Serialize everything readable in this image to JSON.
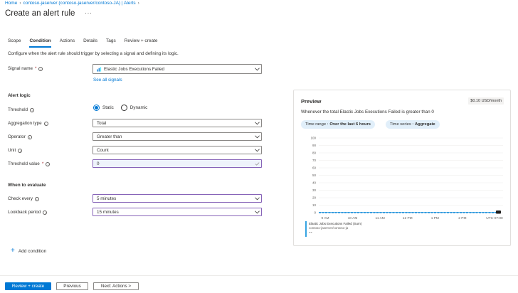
{
  "breadcrumb": [
    {
      "label": "Home"
    },
    {
      "label": "contoso-jaserver/contoso-JA) | Alerts"
    }
  ],
  "breadcrumb_middle": "contoso-jaserver (contoso-jaserver/contoso-JA) | Alerts",
  "page": {
    "title": "Create an alert rule",
    "more": "···"
  },
  "tabs": [
    {
      "label": "Scope"
    },
    {
      "label": "Condition",
      "active": true
    },
    {
      "label": "Actions"
    },
    {
      "label": "Details"
    },
    {
      "label": "Tags"
    },
    {
      "label": "Review + create"
    }
  ],
  "description": "Configure when the alert rule should trigger by selecting a signal and defining its logic.",
  "signal": {
    "label": "Signal name",
    "required": "*",
    "value": "Elastic Jobs Executions Failed",
    "see_all": "See all signals"
  },
  "alert_logic": {
    "title": "Alert logic",
    "threshold_label": "Threshold",
    "threshold_options": [
      "Static",
      "Dynamic"
    ],
    "aggregation_label": "Aggregation type",
    "aggregation_value": "Total",
    "operator_label": "Operator",
    "operator_value": "Greater than",
    "unit_label": "Unit",
    "unit_value": "Count",
    "threshold_value_label": "Threshold value",
    "threshold_value": "0"
  },
  "evaluate": {
    "title": "When to evaluate",
    "check_label": "Check every",
    "check_value": "5 minutes",
    "lookback_label": "Lookback period",
    "lookback_value": "15 minutes"
  },
  "add_condition": "Add condition",
  "footer": {
    "review": "Review + create",
    "previous": "Previous",
    "next": "Next: Actions >"
  },
  "preview": {
    "title": "Preview",
    "price": "$0.10 USD/month",
    "subtitle": "Whenever the total Elastic Jobs Executions Failed is greater than 0",
    "time_range_label": "Time range :",
    "time_range_value": "Over the last 6 hours",
    "time_series_label": "Time series :",
    "time_series_value": "Aggregate",
    "legend_name": "Elastic Jobs Executions Failed (Sum)",
    "legend_sub": "contoso-jaserver/contoso-ja",
    "legend_value": "--"
  },
  "colors": {
    "accent": "#0078d4",
    "focus": "#8764b8",
    "series": "#36a4e2"
  },
  "chart_data": {
    "type": "line",
    "y_ticks": [
      "0",
      "10",
      "20",
      "30",
      "40",
      "50",
      "60",
      "70",
      "80",
      "90",
      "100"
    ],
    "ylim": [
      0,
      100
    ],
    "x_ticks": [
      "9 AM",
      "10 AM",
      "11 AM",
      "12 PM",
      "1 PM",
      "2 PM",
      "UTC-07:00"
    ],
    "series": [
      {
        "name": "Elastic Jobs Executions Failed (Sum)",
        "values": [
          0,
          0,
          0,
          0,
          0,
          0,
          0
        ]
      }
    ],
    "threshold": 0,
    "grid": true
  }
}
